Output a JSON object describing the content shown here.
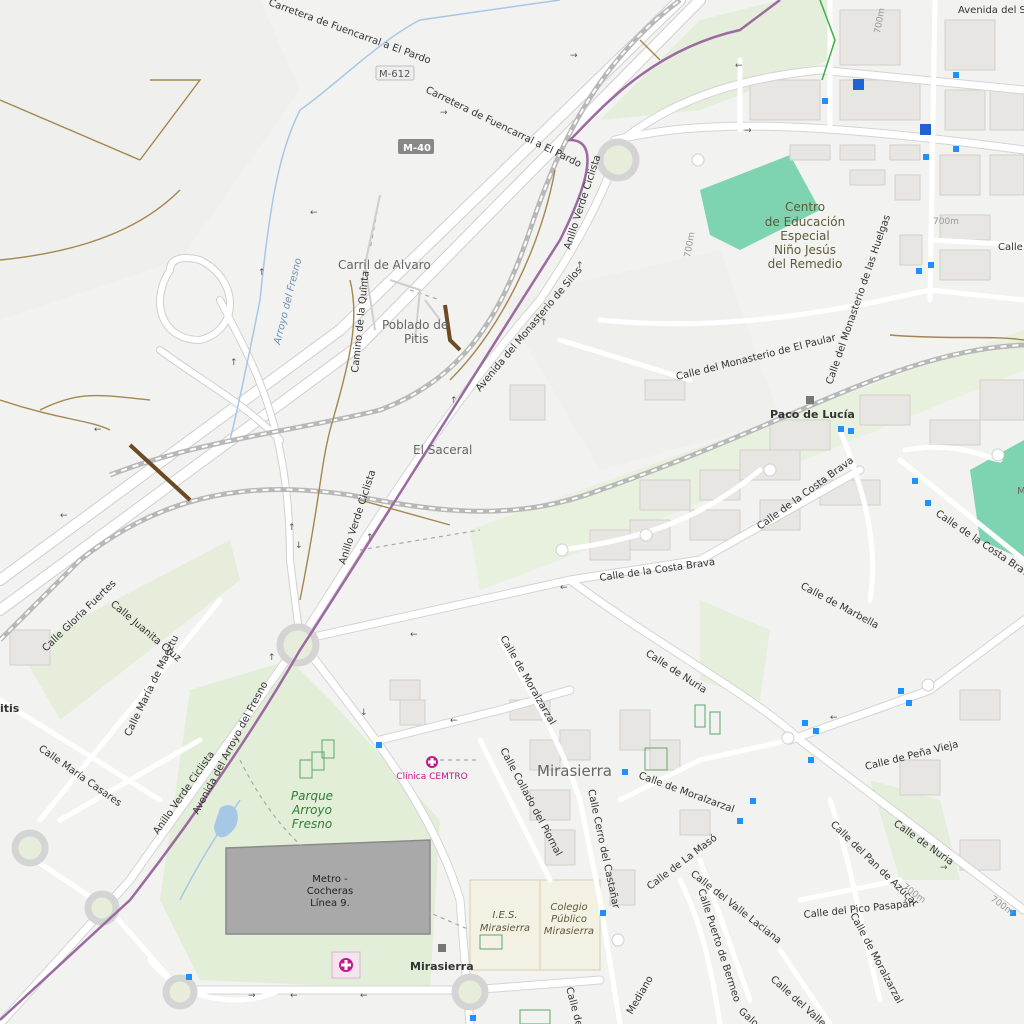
{
  "map": {
    "colors": {
      "background": "#f2f2f0",
      "road": "#ffffff",
      "road_casing": "#d2d2d2",
      "cycleway": "#9b6aa0",
      "railway": "#b5b5b5",
      "track": "#a4864f",
      "green_area": "#e6eedb",
      "school_area": "#f3f0e4",
      "special_area": "#7ed4b0",
      "depot": "#a9a9a9",
      "bus_stop": "#1e90ff",
      "clinic": "#c2188b"
    },
    "road_shields": {
      "m612": "M-612",
      "m40": "M-40"
    },
    "street_labels": {
      "carretera_fuencarral_top": "Carretera de Fuencarral a El Pardo",
      "carretera_fuencarral_mid": "Carretera de Fuencarral a El Pardo",
      "avenida_sa": "Avenida del Sa",
      "camino_quinta": "Camino de la Quinta",
      "arroyo_fresno_stream": "Arroyo del Fresno",
      "anillo_verde_1": "Anillo Verde Ciclista",
      "anillo_verde_2": "Anillo Verde Ciclista",
      "anillo_verde_3": "Anillo Verde Ciclista",
      "av_monasterio_silos": "Avenida del Monasterio de Silos",
      "calle_monasterio_paular": "Calle del Monasterio de El Paular",
      "calle_monasterio_huelgas": "Calle del Monasterio de las Huelgas",
      "calle_costa_brava_1": "Calle de la Costa Brava",
      "calle_costa_brava_2": "Calle de la Costa Brava",
      "calle_costa_brava_3": "Calle de la Costa Brava",
      "calle_marbella": "Calle de Marbella",
      "calle_nuria_1": "Calle de Nuria",
      "calle_nuria_2": "Calle de Nuria",
      "calle_moralzarzal_1": "Calle de Moralzarzal",
      "calle_moralzarzal_2": "Calle de Moralzarzal",
      "calle_moralzarzal_3": "Calle de Moralzarzal",
      "calle_collado_piornal": "Calle Collado del Piornal",
      "calle_cerro_castanar": "Calle Cerro del Castañar",
      "calle_la_maso": "Calle de La Masó",
      "calle_valle_laciana": "Calle del Valle Laciana",
      "calle_puerto_bermeo": "Calle Puerto de Bermeo",
      "calle_pico_pasapan": "Calle del Pico Pasapán",
      "calle_pan_azucar": "Calle del Pan de Azúcar",
      "calle_pena_vieja": "Calle de Peña Vieja",
      "av_arroyo_fresno": "Avenida del Arroyo del Fresno",
      "calle_gloria_fuertes": "Calle Gloria Fuertes",
      "calle_juanita_cruz": "Calle Juanita Cruz",
      "calle_maria_maeztu": "Calle María de Maeztu",
      "calle_maria_casares": "Calle María Casares",
      "calle_mediano": "Mediano",
      "calle_valle": "Calle del Valle",
      "calle_galou": "Galou",
      "calle_de_bottom": "Calle de",
      "calle_le": "Calle Le"
    },
    "place_labels": {
      "carril_alvaro": "Carril de Alvaro",
      "poblado_pitis_1": "Poblado de",
      "poblado_pitis_2": "Pitis",
      "el_saceral": "El Saceral",
      "mirasierra_area": "Mirasierra",
      "pitis_edge": "itis",
      "m_edge": "M"
    },
    "poi_labels": {
      "centro_1": "Centro",
      "centro_2": "de Educación",
      "centro_3": "Especial",
      "centro_4": "Niño Jesús",
      "centro_5": "del Remedio",
      "ies_1": "I.E.S.",
      "ies_2": "Mirasierra",
      "colegio_1": "Colegio",
      "colegio_2": "Público",
      "colegio_3": "Mirasierra",
      "clinica": "Clínica CEMTRO"
    },
    "park_labels": {
      "parque_1": "Parque",
      "parque_2": "Arroyo",
      "parque_3": "Fresno"
    },
    "depot_labels": {
      "line1": "Metro -",
      "line2": "Cocheras",
      "line3": "Línea 9."
    },
    "station_labels": {
      "paco_de_lucia": "Paco de Lucía",
      "mirasierra": "Mirasierra"
    },
    "contour_labels": {
      "c1": "700m",
      "c2": "700m",
      "c3": "700m",
      "c4": "700m",
      "c5": "700m"
    }
  }
}
